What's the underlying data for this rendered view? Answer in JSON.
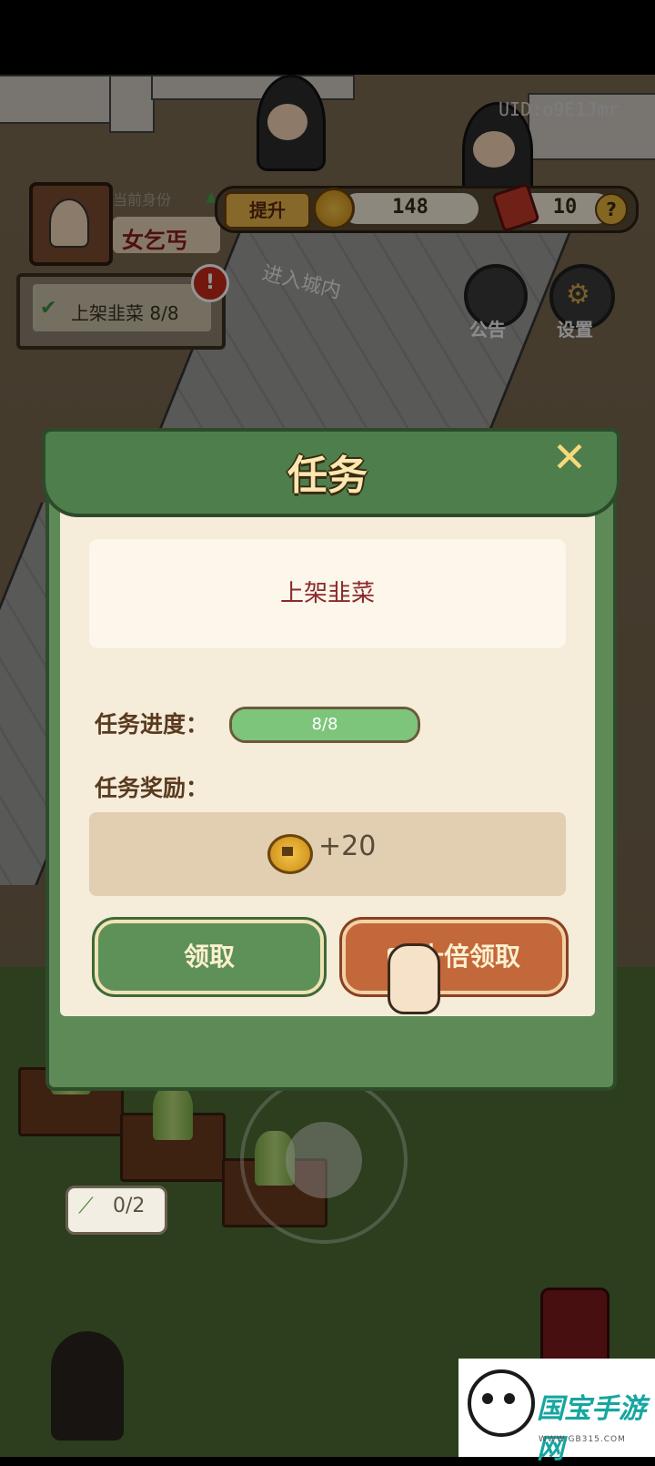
{
  "hud": {
    "uid": "UID:o9E1Jmr",
    "identity_label": "当前身份",
    "identity_value": "女乞丐",
    "upgrade_label": "提升",
    "coins": "148",
    "tickets": "10",
    "help": "?",
    "gate_sign": "进入城内",
    "notice_label": "公告",
    "settings_label": "设置"
  },
  "quest_tracker": {
    "check": "✔",
    "text": "上架韭菜 8/8",
    "alert": "!"
  },
  "modal": {
    "title": "任务",
    "close": "✕",
    "task_name": "上架韭菜",
    "progress_label": "任务进度：",
    "progress_text": "8/8",
    "progress_fraction": 1.0,
    "reward_label": "任务奖励：",
    "reward_amount": "+20",
    "claim_label": "领取",
    "claim_10x_label": "十倍领取"
  },
  "harvest_counter": "0/2",
  "watermark": {
    "text": "国宝手游网",
    "url": "WWW.GB315.COM"
  },
  "colors": {
    "modal_green": "#5d8a57",
    "body_cream": "#f5ecda",
    "task_red": "#8b2a2a",
    "progress_green": "#7cc57a",
    "button_orange": "#c3683b"
  }
}
